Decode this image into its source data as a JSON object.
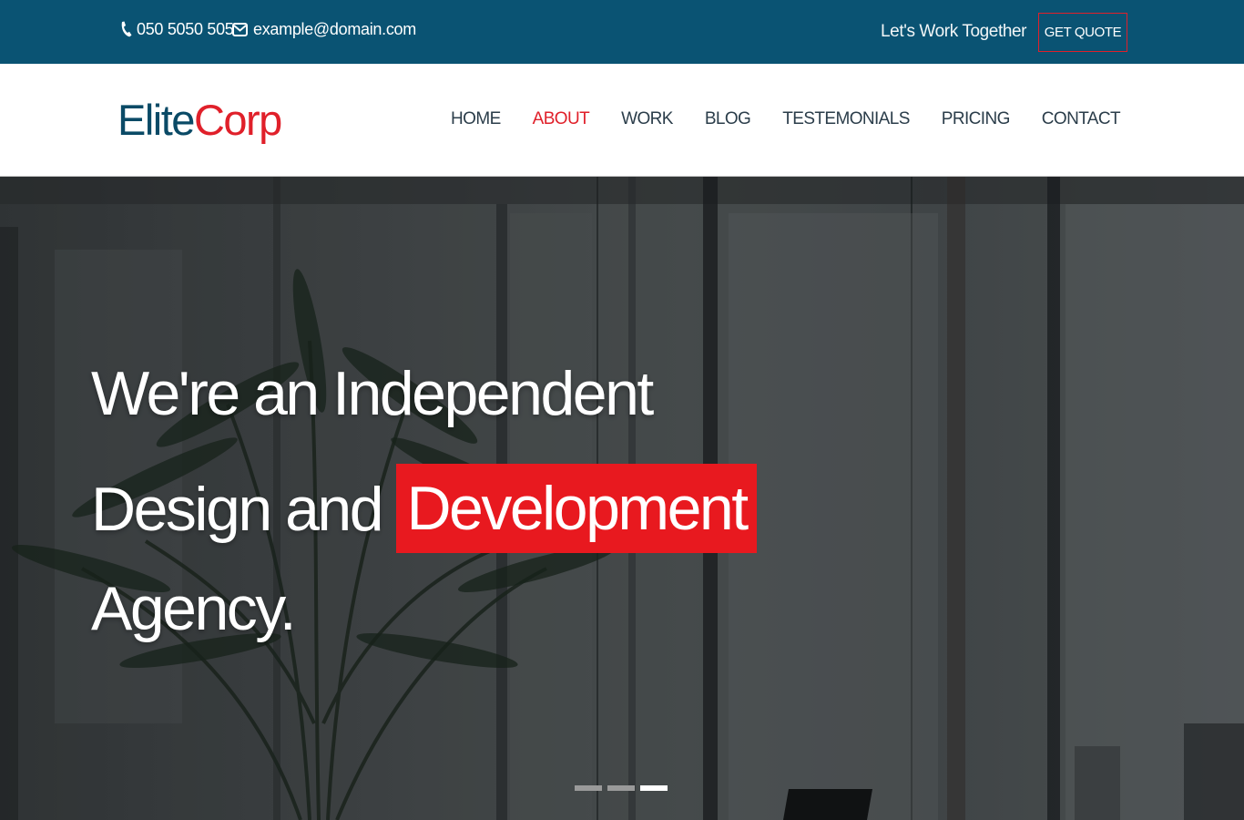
{
  "topbar": {
    "phone": "050 5050 505",
    "email": "example@domain.com",
    "tagline": "Let's Work Together",
    "quote_button": "GET QUOTE",
    "phone_icon": "phone-icon",
    "email_icon": "envelope-icon"
  },
  "header": {
    "logo_part1": "Elite",
    "logo_part2": "Corp",
    "nav": [
      {
        "label": "HOME",
        "active": false
      },
      {
        "label": "ABOUT",
        "active": true
      },
      {
        "label": "WORK",
        "active": false
      },
      {
        "label": "BLOG",
        "active": false
      },
      {
        "label": "TESTEMONIALS",
        "active": false
      },
      {
        "label": "PRICING",
        "active": false
      },
      {
        "label": "CONTACT",
        "active": false
      }
    ]
  },
  "hero": {
    "line1": "We're an Independent",
    "line2_prefix": "Design and",
    "line2_highlight": "Development",
    "line3": "Agency.",
    "slides": [
      {
        "active": false
      },
      {
        "active": false
      },
      {
        "active": true
      }
    ]
  },
  "colors": {
    "topbar_bg": "#0a5373",
    "brand_blue": "#0a4a66",
    "accent_red": "#e0202a",
    "highlight_red": "#e8191f",
    "nav_text": "#2b3d4a"
  }
}
